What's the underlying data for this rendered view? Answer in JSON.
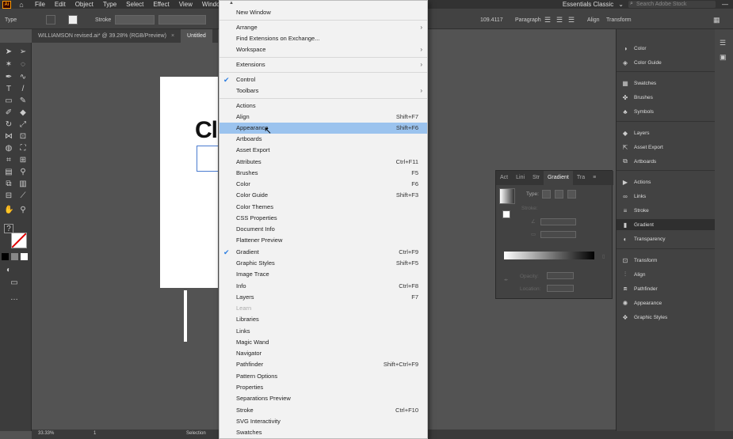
{
  "menubar": {
    "logo": "Ai",
    "items": [
      "File",
      "Edit",
      "Object",
      "Type",
      "Select",
      "Effect",
      "View",
      "Window"
    ],
    "workspace": "Essentials Classic",
    "search_placeholder": "Search Adobe Stock"
  },
  "control": {
    "type_label": "Type",
    "stroke_label": "Stroke",
    "value": "109.4117",
    "paragraph_label": "Paragraph",
    "align_label": "Align",
    "transform_label": "Transform"
  },
  "tabs": [
    {
      "label": "WILLIAMSON revised.ai* @ 39.28% (RGB/Preview)",
      "close": "×"
    },
    {
      "label": "Untitled",
      "close": ""
    }
  ],
  "canvas": {
    "art_text": "Cl"
  },
  "statusbar": {
    "zoom": "33.33%",
    "artboard": "1",
    "tool": "Selection"
  },
  "window_menu": {
    "items": [
      {
        "label": "New Window",
        "shortcut": "",
        "submenu": false,
        "checked": false,
        "disabled": false
      },
      {
        "label": "Arrange",
        "shortcut": "",
        "submenu": true,
        "checked": false,
        "disabled": false
      },
      {
        "label": "Find Extensions on Exchange...",
        "shortcut": "",
        "submenu": false,
        "checked": false,
        "disabled": false
      },
      {
        "label": "Workspace",
        "shortcut": "",
        "submenu": true,
        "checked": false,
        "disabled": false
      },
      {
        "label": "Extensions",
        "shortcut": "",
        "submenu": true,
        "checked": false,
        "disabled": false
      },
      {
        "label": "Control",
        "shortcut": "",
        "submenu": false,
        "checked": true,
        "disabled": false
      },
      {
        "label": "Toolbars",
        "shortcut": "",
        "submenu": true,
        "checked": false,
        "disabled": false
      },
      {
        "label": "Actions",
        "shortcut": "",
        "submenu": false,
        "checked": false,
        "disabled": false
      },
      {
        "label": "Align",
        "shortcut": "Shift+F7",
        "submenu": false,
        "checked": false,
        "disabled": false
      },
      {
        "label": "Appearance",
        "shortcut": "Shift+F6",
        "submenu": false,
        "checked": false,
        "disabled": false,
        "highlighted": true
      },
      {
        "label": "Artboards",
        "shortcut": "",
        "submenu": false,
        "checked": false,
        "disabled": false
      },
      {
        "label": "Asset Export",
        "shortcut": "",
        "submenu": false,
        "checked": false,
        "disabled": false
      },
      {
        "label": "Attributes",
        "shortcut": "Ctrl+F11",
        "submenu": false,
        "checked": false,
        "disabled": false
      },
      {
        "label": "Brushes",
        "shortcut": "F5",
        "submenu": false,
        "checked": false,
        "disabled": false
      },
      {
        "label": "Color",
        "shortcut": "F6",
        "submenu": false,
        "checked": false,
        "disabled": false
      },
      {
        "label": "Color Guide",
        "shortcut": "Shift+F3",
        "submenu": false,
        "checked": false,
        "disabled": false
      },
      {
        "label": "Color Themes",
        "shortcut": "",
        "submenu": false,
        "checked": false,
        "disabled": false
      },
      {
        "label": "CSS Properties",
        "shortcut": "",
        "submenu": false,
        "checked": false,
        "disabled": false
      },
      {
        "label": "Document Info",
        "shortcut": "",
        "submenu": false,
        "checked": false,
        "disabled": false
      },
      {
        "label": "Flattener Preview",
        "shortcut": "",
        "submenu": false,
        "checked": false,
        "disabled": false
      },
      {
        "label": "Gradient",
        "shortcut": "Ctrl+F9",
        "submenu": false,
        "checked": true,
        "disabled": false
      },
      {
        "label": "Graphic Styles",
        "shortcut": "Shift+F5",
        "submenu": false,
        "checked": false,
        "disabled": false
      },
      {
        "label": "Image Trace",
        "shortcut": "",
        "submenu": false,
        "checked": false,
        "disabled": false
      },
      {
        "label": "Info",
        "shortcut": "Ctrl+F8",
        "submenu": false,
        "checked": false,
        "disabled": false
      },
      {
        "label": "Layers",
        "shortcut": "F7",
        "submenu": false,
        "checked": false,
        "disabled": false
      },
      {
        "label": "Learn",
        "shortcut": "",
        "submenu": false,
        "checked": false,
        "disabled": true
      },
      {
        "label": "Libraries",
        "shortcut": "",
        "submenu": false,
        "checked": false,
        "disabled": false
      },
      {
        "label": "Links",
        "shortcut": "",
        "submenu": false,
        "checked": false,
        "disabled": false
      },
      {
        "label": "Magic Wand",
        "shortcut": "",
        "submenu": false,
        "checked": false,
        "disabled": false
      },
      {
        "label": "Navigator",
        "shortcut": "",
        "submenu": false,
        "checked": false,
        "disabled": false
      },
      {
        "label": "Pathfinder",
        "shortcut": "Shift+Ctrl+F9",
        "submenu": false,
        "checked": false,
        "disabled": false
      },
      {
        "label": "Pattern Options",
        "shortcut": "",
        "submenu": false,
        "checked": false,
        "disabled": false
      },
      {
        "label": "Properties",
        "shortcut": "",
        "submenu": false,
        "checked": false,
        "disabled": false
      },
      {
        "label": "Separations Preview",
        "shortcut": "",
        "submenu": false,
        "checked": false,
        "disabled": false
      },
      {
        "label": "Stroke",
        "shortcut": "Ctrl+F10",
        "submenu": false,
        "checked": false,
        "disabled": false
      },
      {
        "label": "SVG Interactivity",
        "shortcut": "",
        "submenu": false,
        "checked": false,
        "disabled": false
      },
      {
        "label": "Swatches",
        "shortcut": "",
        "submenu": false,
        "checked": false,
        "disabled": false
      }
    ]
  },
  "gradient_panel": {
    "tabs": [
      "Act",
      "Lini",
      "Str",
      "Gradient",
      "Tra"
    ],
    "active_tab": "Gradient",
    "type_label": "Type:",
    "stroke_label": "Stroke:",
    "opacity_label": "Opacity:",
    "location_label": "Location:"
  },
  "right_panel": {
    "items": [
      {
        "label": "Color",
        "icon": "color-icon"
      },
      {
        "label": "Color Guide",
        "icon": "color-guide-icon"
      },
      {
        "label": "Swatches",
        "icon": "swatches-icon"
      },
      {
        "label": "Brushes",
        "icon": "brushes-icon"
      },
      {
        "label": "Symbols",
        "icon": "symbols-icon"
      },
      {
        "label": "Layers",
        "icon": "layers-icon"
      },
      {
        "label": "Asset Export",
        "icon": "asset-export-icon"
      },
      {
        "label": "Artboards",
        "icon": "artboards-icon"
      },
      {
        "label": "Actions",
        "icon": "actions-icon"
      },
      {
        "label": "Links",
        "icon": "links-icon"
      },
      {
        "label": "Stroke",
        "icon": "stroke-icon"
      },
      {
        "label": "Gradient",
        "icon": "gradient-icon",
        "active": true
      },
      {
        "label": "Transparency",
        "icon": "transparency-icon"
      },
      {
        "label": "Transform",
        "icon": "transform-icon"
      },
      {
        "label": "Align",
        "icon": "align-icon"
      },
      {
        "label": "Pathfinder",
        "icon": "pathfinder-icon"
      },
      {
        "label": "Appearance",
        "icon": "appearance-icon"
      },
      {
        "label": "Graphic Styles",
        "icon": "graphic-styles-icon"
      }
    ]
  },
  "colors": {
    "menu_highlight": "#9bc3ee",
    "check": "#2b7de1",
    "app_bg": "#535353",
    "panel_bg": "#424242"
  }
}
